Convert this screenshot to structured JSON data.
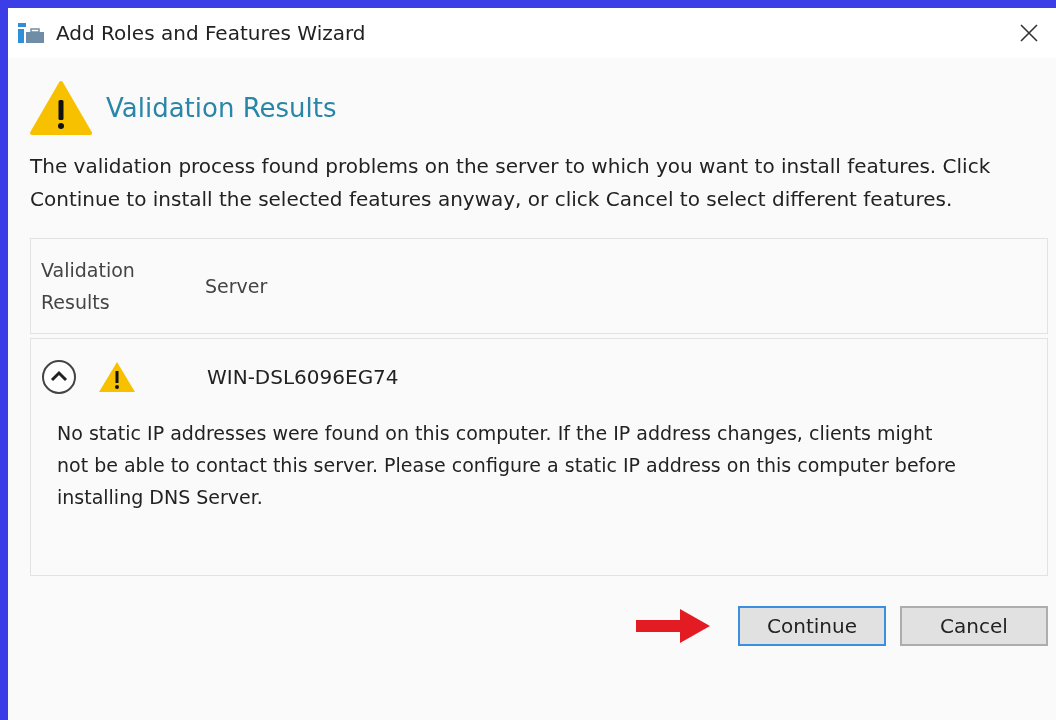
{
  "window": {
    "title": "Add Roles and Features Wizard"
  },
  "heading": "Validation Results",
  "description": "The validation process found problems on the server to which you want to install features. Click Continue to install the selected features anyway, or click Cancel to select different features.",
  "table": {
    "columns": [
      "Validation Results",
      "Server"
    ],
    "rows": [
      {
        "server": "WIN-DSL6096EG74",
        "expanded": true,
        "message": "No static IP addresses were found on this computer. If the IP address changes, clients might not be able to contact this server. Please configure a static IP address on this computer before installing DNS Server."
      }
    ]
  },
  "buttons": [
    {
      "label": "Continue",
      "default": true
    },
    {
      "label": "Cancel",
      "default": false
    }
  ]
}
